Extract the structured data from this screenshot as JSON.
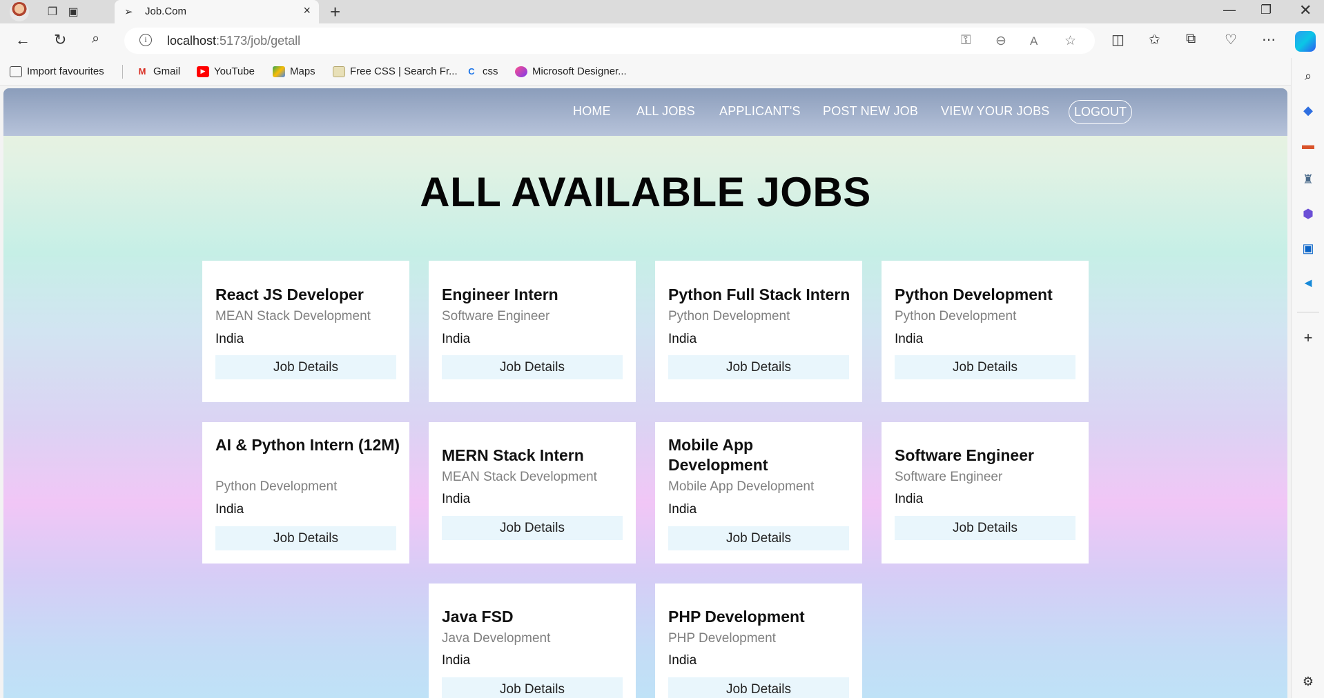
{
  "browser": {
    "tab_title": "Job.Com",
    "url_host": "localhost",
    "url_path": ":5173/job/getall",
    "bookmarks": [
      {
        "label": "Import favourites",
        "icon": "import-icon"
      },
      {
        "label": "Gmail",
        "icon": "gmail-icon"
      },
      {
        "label": "YouTube",
        "icon": "youtube-icon"
      },
      {
        "label": "Maps",
        "icon": "maps-icon"
      },
      {
        "label": "Free CSS | Search Fr...",
        "icon": "freecss-icon"
      },
      {
        "label": "css",
        "icon": "css-icon"
      },
      {
        "label": "Microsoft Designer...",
        "icon": "designer-icon"
      }
    ]
  },
  "nav": {
    "links": [
      "HOME",
      "ALL JOBS",
      "APPLICANT'S",
      "POST NEW JOB",
      "VIEW YOUR JOBS"
    ],
    "logout": "LOGOUT"
  },
  "page": {
    "title": "ALL AVAILABLE JOBS",
    "jobs": [
      {
        "title": "React JS Developer",
        "category": "MEAN Stack Development",
        "country": "India",
        "button": "Job Details"
      },
      {
        "title": "Engineer Intern",
        "category": "Software Engineer",
        "country": "India",
        "button": "Job Details"
      },
      {
        "title": "Python Full Stack Intern",
        "category": "Python Development",
        "country": "India",
        "button": "Job Details"
      },
      {
        "title": "Python Development",
        "category": "Python Development",
        "country": "India",
        "button": "Job Details"
      },
      {
        "title": "AI & Python Intern (12M)",
        "category": "Python Development",
        "country": "India",
        "button": "Job Details"
      },
      {
        "title": "MERN Stack Intern",
        "category": "MEAN Stack Development",
        "country": "India",
        "button": "Job Details"
      },
      {
        "title": "Mobile App Development",
        "category": "Mobile App Development",
        "country": "India",
        "button": "Job Details"
      },
      {
        "title": "Software Engineer",
        "category": "Software Engineer",
        "country": "India",
        "button": "Job Details"
      },
      {
        "title": "Java FSD",
        "category": "Java Development",
        "country": "India",
        "button": "Job Details"
      },
      {
        "title": "PHP Development",
        "category": "PHP Development",
        "country": "India",
        "button": "Job Details"
      }
    ]
  }
}
